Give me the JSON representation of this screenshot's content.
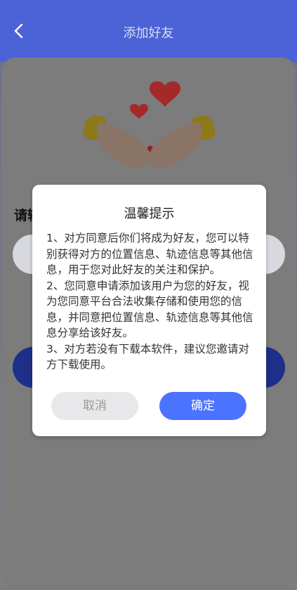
{
  "header": {
    "title": "添加好友",
    "back_icon": "chevron-left-icon"
  },
  "page": {
    "request_label_partial": "请输"
  },
  "dialog": {
    "title": "温馨提示",
    "lines": [
      "1、对方同意后你们将成为好友，您可以特别获得对方的位置信息、轨迹信息等其他信息，用于您对此好友的关注和保护。",
      "2、您同意申请添加该用户为您的好友，视为您同意平台合法收集存储和使用您的信息，并同意把位置信息、轨迹信息等其他信息分享给该好友。",
      "3、对方若没有下载本软件，建议您邀请对方下载使用。"
    ],
    "cancel_label": "取消",
    "ok_label": "确定"
  },
  "colors": {
    "accent": "#4c73ff",
    "header": "#4b63d6",
    "cancel_bg": "#e8e8ea"
  }
}
